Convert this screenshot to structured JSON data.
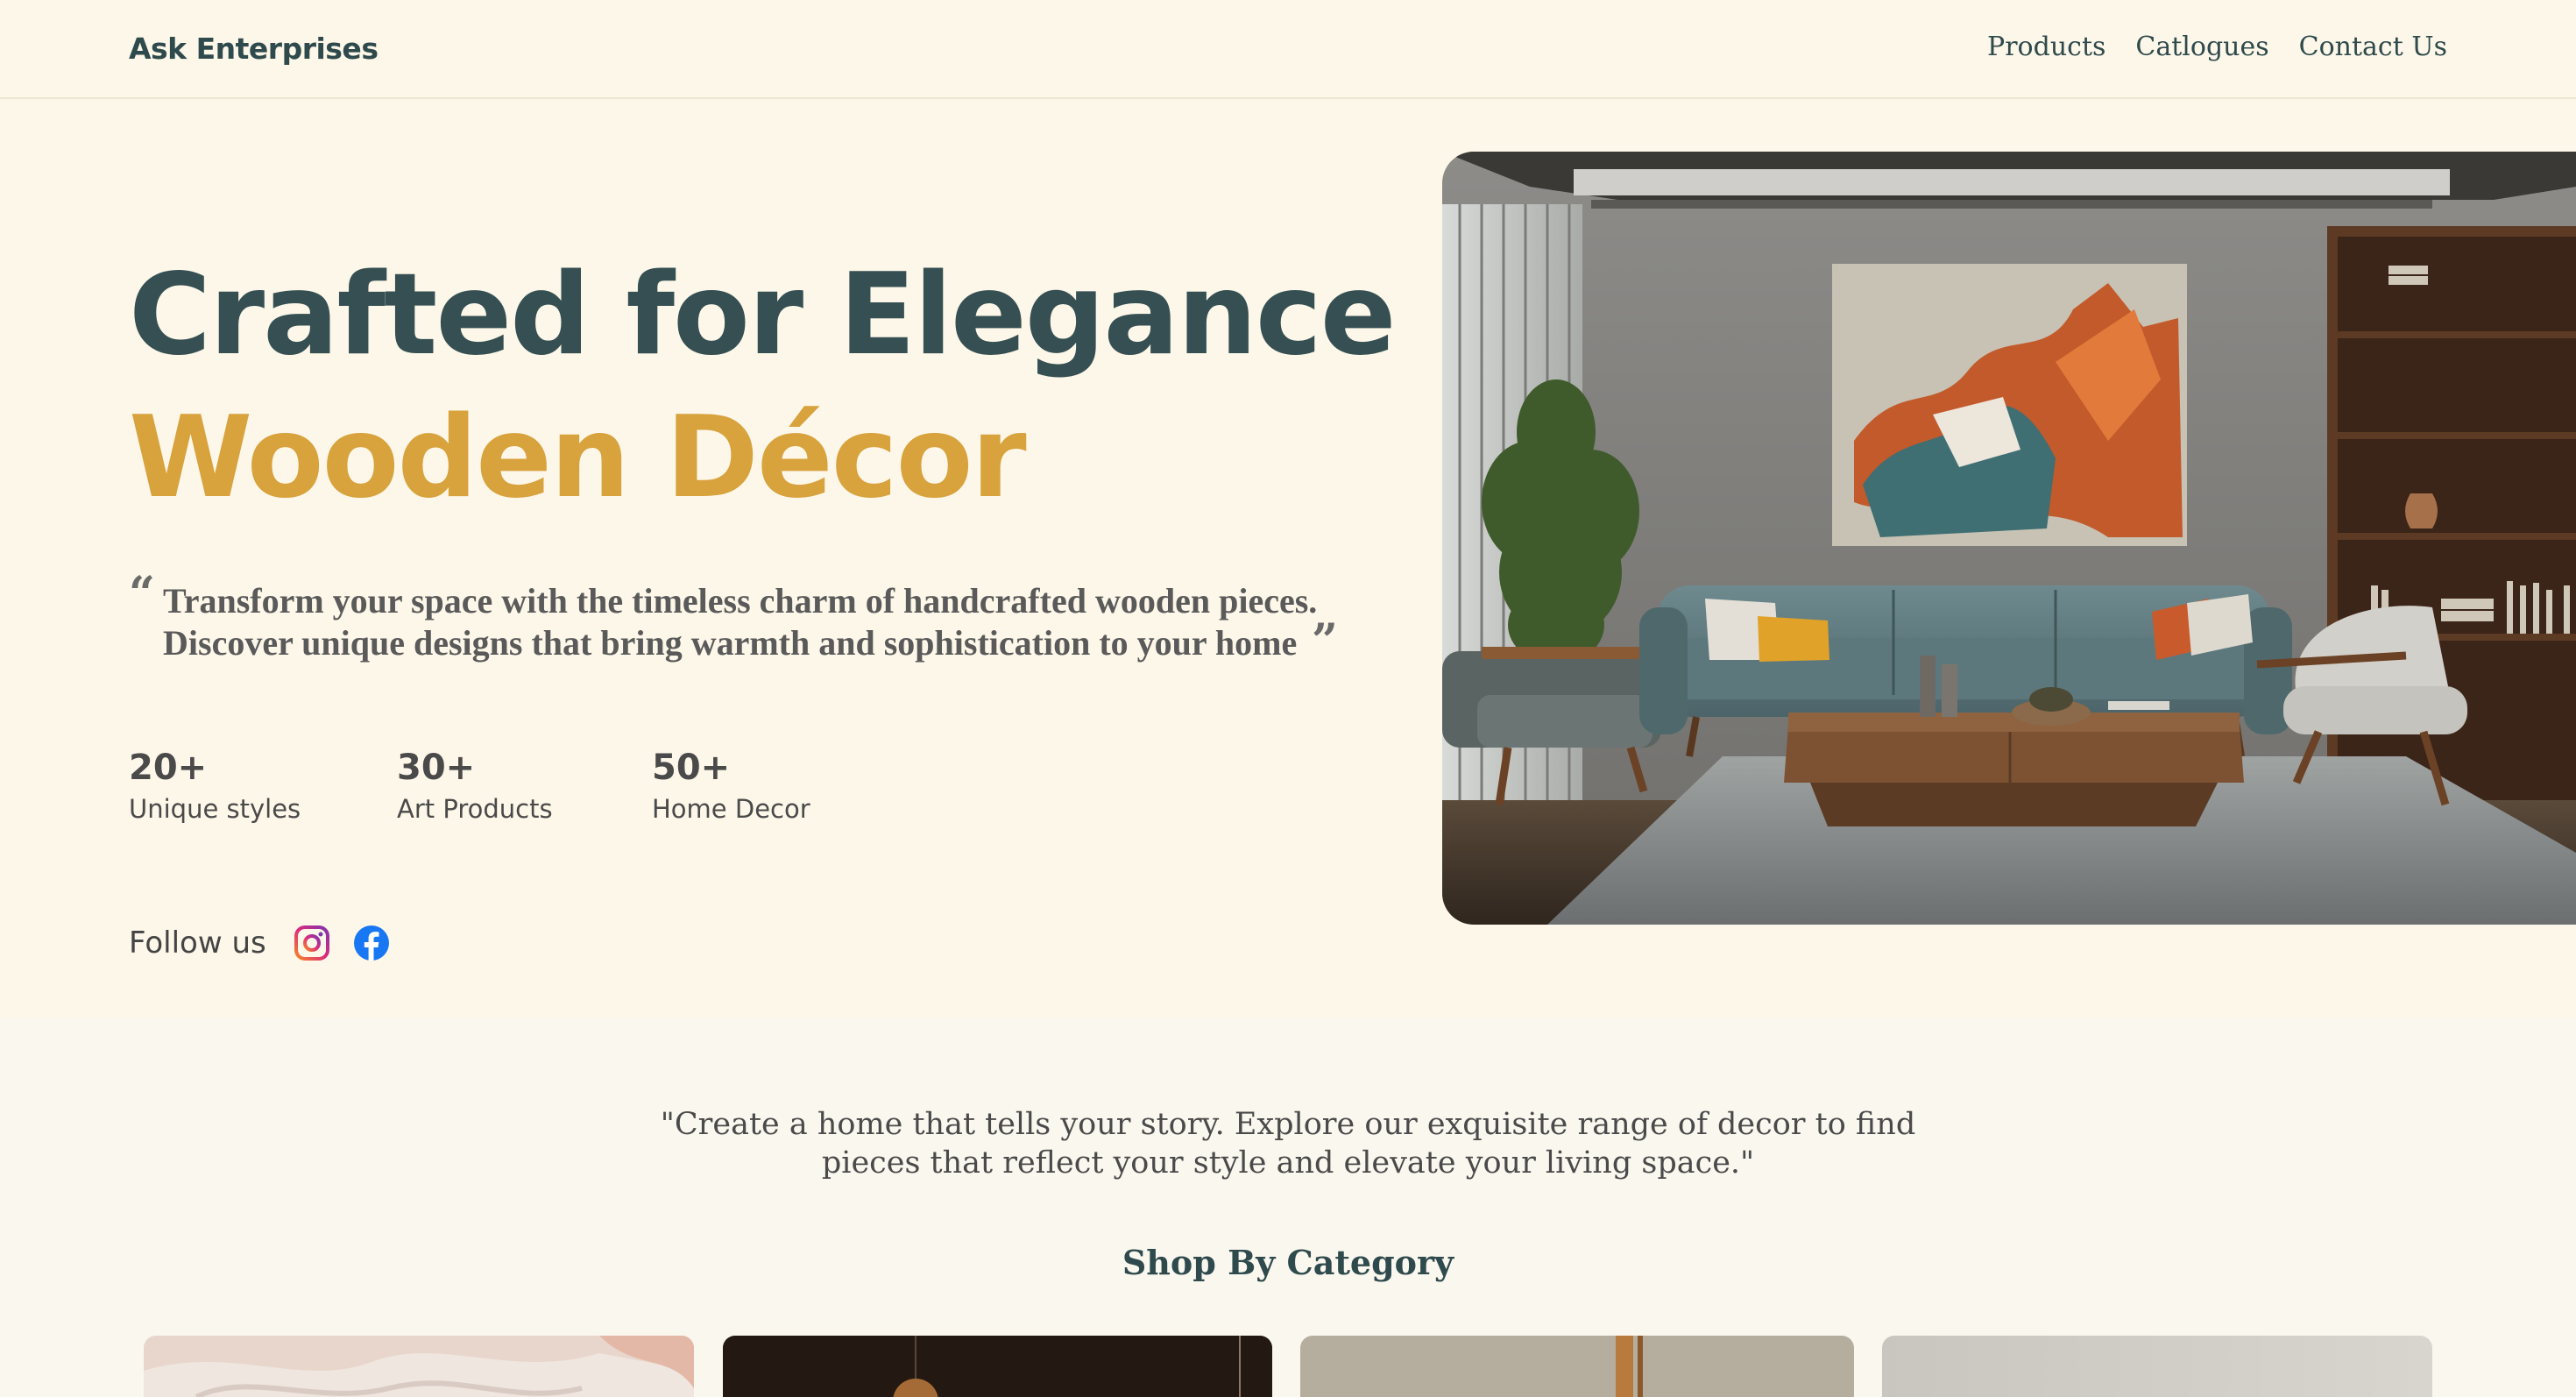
{
  "header": {
    "brand": "Ask Enterprises",
    "nav": [
      "Products",
      "Catlogues",
      "Contact Us"
    ]
  },
  "hero": {
    "title": "Crafted for Elegance",
    "subtitle": "Wooden Décor",
    "quote_line1": "Transform your space with the timeless charm of handcrafted wooden pieces.",
    "quote_line2": "Discover unique designs that bring warmth and sophistication to your home",
    "open_quote": "“",
    "close_quote": "”",
    "stats": [
      {
        "value": "20+",
        "label": "Unique styles"
      },
      {
        "value": "30+",
        "label": "Art Products"
      },
      {
        "value": "50+",
        "label": "Home Decor"
      }
    ],
    "follow_label": "Follow us",
    "social_icons": [
      "instagram-icon",
      "facebook-icon"
    ]
  },
  "lower": {
    "quote_line1": "\"Create a home that tells your story. Explore our exquisite range of decor to find",
    "quote_line2": "pieces that reflect your style and elevate your living space.\"",
    "section_title": "Shop By Category"
  },
  "colors": {
    "background": "#fdf7e9",
    "lower_background": "#faf7ef",
    "primary_text": "#354f52",
    "accent": "#d8a23d",
    "instagram": "#c13584",
    "facebook": "#1877f2"
  }
}
